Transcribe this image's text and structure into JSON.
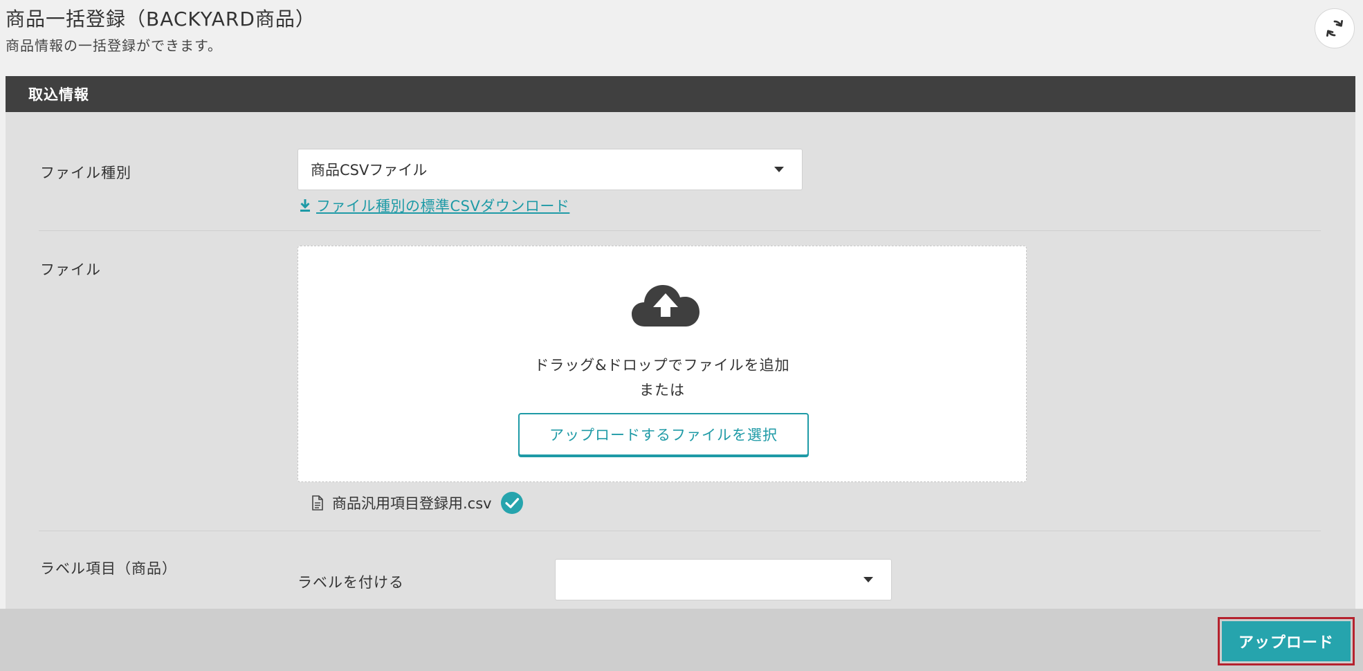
{
  "header": {
    "title": "商品一括登録（BACKYARD商品）",
    "subtitle": "商品情報の一括登録ができます。"
  },
  "panel": {
    "title": "取込情報"
  },
  "file_type": {
    "label": "ファイル種別",
    "selected": "商品CSVファイル",
    "download_link": "ファイル種別の標準CSVダウンロード"
  },
  "file": {
    "label": "ファイル",
    "drop_text": "ドラッグ&ドロップでファイルを追加",
    "or_text": "または",
    "select_button": "アップロードするファイルを選択",
    "selected_file_name": "商品汎用項目登録用.csv"
  },
  "label_item": {
    "label": "ラベル項目（商品）",
    "attach_label": "ラベルを付ける",
    "selected": ""
  },
  "footer": {
    "upload_button": "アップロード"
  },
  "colors": {
    "accent": "#26a4ad",
    "header_bar": "#404040",
    "highlight_border": "#b5222e"
  },
  "icons": {
    "refresh": "refresh-icon",
    "download": "download-icon",
    "upload_cloud": "cloud-upload-icon",
    "file": "file-icon",
    "check": "check-circle-icon"
  }
}
